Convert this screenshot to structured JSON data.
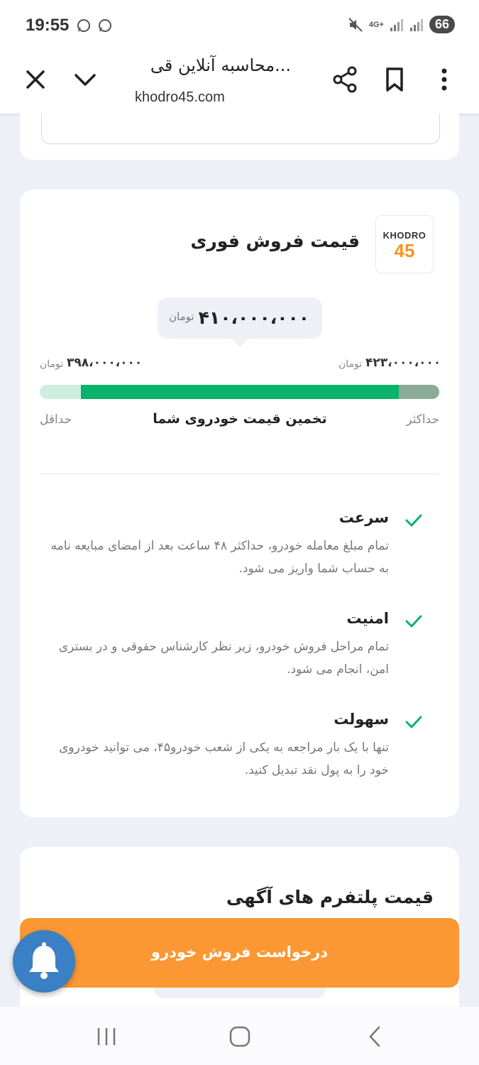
{
  "status_bar": {
    "time": "19:55",
    "network": "4G+",
    "battery": "66",
    "icons": [
      "whatsapp-icon",
      "whatsapp-icon",
      "mute-icon",
      "signal-icon",
      "signal-icon"
    ]
  },
  "browser": {
    "title": "محاسبه آنلاین قی...",
    "url": "khodro45.com",
    "icons": [
      "close-icon",
      "chevron-down-icon",
      "share-icon",
      "bookmark-icon",
      "more-vert-icon"
    ]
  },
  "instant_sale_card": {
    "logo_top": "KHODRO",
    "logo_num": "45",
    "title": "قیمت فروش فوری",
    "estimate_value": "۴۱۰،۰۰۰،۰۰۰",
    "unit": "تومان",
    "min_value": "۳۹۸،۰۰۰،۰۰۰",
    "max_value": "۴۲۳،۰۰۰،۰۰۰",
    "label_min": "حداقل",
    "label_max": "حداکثر",
    "label_estimate": "تخمین قیمت خودروی شما",
    "estimate_position_fraction": 0.48,
    "features": [
      {
        "title": "سرعت",
        "desc": "تمام مبلغ معامله خودرو، حداکثر ۴۸ ساعت بعد از امضای مبایعه نامه به حساب شما واریز می شود."
      },
      {
        "title": "امنیت",
        "desc": "تمام مراحل فروش خودرو، زیر نظر کارشناس حقوقی و در بستری امن، انجام می شود."
      },
      {
        "title": "سهولت",
        "desc": "تنها با یک بار مراجعه به یکی از شعب خودرو۴۵، می توانید خودروی خود را به پول نقد تبدیل کنید."
      }
    ]
  },
  "platform_card": {
    "title": "قیمت پلتفرم های آگهی"
  },
  "cta": {
    "label": "درخواست فروش خودرو"
  },
  "colors": {
    "accent_orange": "#fb9833",
    "bar_green": "#0bb36a",
    "check_green": "#0bb36a",
    "bell_blue": "#3b7fc4"
  },
  "nav_bar": {
    "icons": [
      "recent-apps-icon",
      "home-icon",
      "back-icon"
    ]
  }
}
